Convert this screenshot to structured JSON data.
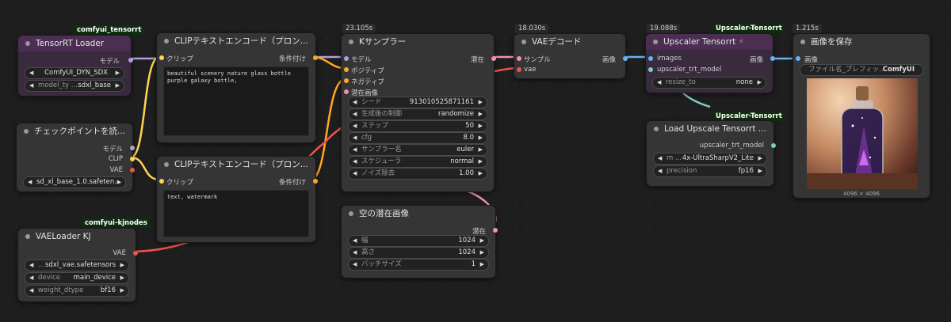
{
  "badges": {
    "tensorrt": "comfyui_tensorrt",
    "kjnodes": "comfyui-kjnodes",
    "upscaler1": "Upscaler-Tensorrt",
    "upscaler2": "Upscaler-Tensorrt",
    "upscaler3": "Upscaler-Tensorrt"
  },
  "times": {
    "ksampler": "23.105s",
    "vae": "18.030s",
    "upscaler": "19.088s",
    "save": "1.215s"
  },
  "trt_loader": {
    "title": "TensorRT Loader",
    "out_model": "モデル",
    "w1_val": "ComfyUI_DYN_SDX",
    "w2_lab": "model_ty ...",
    "w2_val": "sdxl_base"
  },
  "checkpoint": {
    "title": "チェックポイントを読...",
    "out_model": "モデル",
    "out_clip": "CLIP",
    "out_vae": "VAE",
    "w1_val": "sd_xl_base_1.0.safeten..."
  },
  "vaeloader": {
    "title": "VAELoader KJ",
    "out_vae": "VAE",
    "w1_lab": "...",
    "w1_val": "sdxl_vae.safetensors",
    "w2_lab": "device",
    "w2_val": "main_device",
    "w3_lab": "weight_dtype",
    "w3_val": "bf16"
  },
  "clip_pos": {
    "title": "CLIPテキストエンコード（プロン...",
    "in_clip": "クリップ",
    "out": "条件付け",
    "text": "beautiful scenery nature glass bottle purple galaxy bottle,"
  },
  "clip_neg": {
    "title": "CLIPテキストエンコード（プロン...",
    "in_clip": "クリップ",
    "out": "条件付け",
    "text": "text, watermark"
  },
  "ksampler": {
    "title": "Kサンプラー",
    "in_model": "モデル",
    "in_pos": "ポジティブ",
    "in_neg": "ネガティブ",
    "in_latent": "潜在画像",
    "out": "潜在",
    "widgets": [
      {
        "lab": "シード",
        "val": "913010525871161"
      },
      {
        "lab": "生成後の制御",
        "val": "randomize"
      },
      {
        "lab": "ステップ",
        "val": "50"
      },
      {
        "lab": "cfg",
        "val": "8.0"
      },
      {
        "lab": "サンプラー名",
        "val": "euler"
      },
      {
        "lab": "スケジューラ",
        "val": "normal"
      },
      {
        "lab": "ノイズ除去",
        "val": "1.00"
      }
    ]
  },
  "empty_latent": {
    "title": "空の潜在画像",
    "out": "潜在",
    "widgets": [
      {
        "lab": "幅",
        "val": "1024"
      },
      {
        "lab": "高さ",
        "val": "1024"
      },
      {
        "lab": "バッチサイズ",
        "val": "1"
      }
    ]
  },
  "vaedecode": {
    "title": "VAEデコード",
    "in_samples": "サンプル",
    "in_vae": "vae",
    "out": "画像"
  },
  "upscaler": {
    "title": "Upscaler Tensorrt",
    "bolt": "⚡",
    "in_images": "images",
    "in_model": "upscaler_trt_model",
    "out": "画像",
    "w1_lab": "resize_to",
    "w1_val": "none"
  },
  "load_upscale": {
    "title": "Load Upscale Tensorrt ...",
    "out": "upscaler_trt_model",
    "w1_lab": "m ...",
    "w1_val": "4x-UltraSharpV2_Lite",
    "w2_lab": "precision",
    "w2_val": "fp16"
  },
  "save": {
    "title": "画像を保存",
    "in": "画像",
    "w1_lab": "ファイル名_プレフィッ...",
    "w1_val": "ComfyUI",
    "size": "4096 × 4096"
  }
}
